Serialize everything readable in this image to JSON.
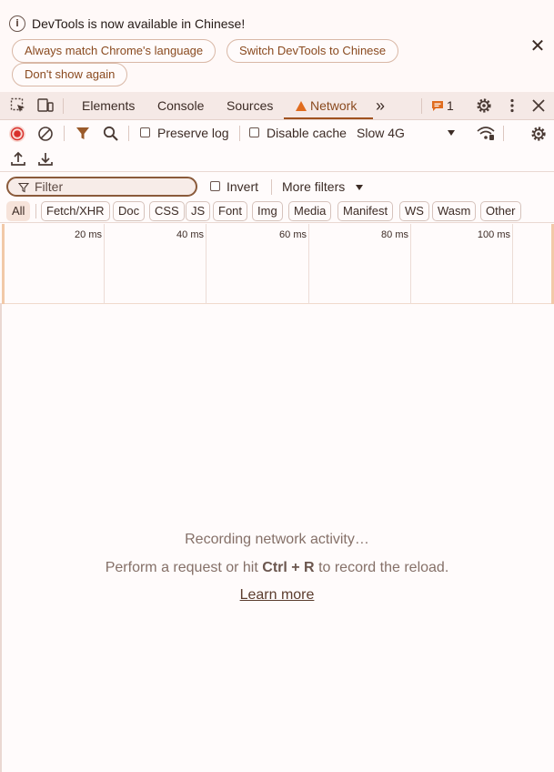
{
  "infobar": {
    "message": "DevTools is now available in Chinese!",
    "buttons": {
      "match_language": "Always match Chrome's language",
      "switch_language": "Switch DevTools to Chinese",
      "dont_show": "Don't show again"
    },
    "close_glyph": "✕"
  },
  "tabs": {
    "elements": "Elements",
    "console": "Console",
    "sources": "Sources",
    "network": "Network",
    "more_glyph": "»",
    "issues_count": "1"
  },
  "network_toolbar": {
    "preserve_log": "Preserve log",
    "disable_cache": "Disable cache",
    "throttling": "Slow 4G"
  },
  "filter": {
    "placeholder": "Filter",
    "invert": "Invert",
    "more_filters": "More filters"
  },
  "type_filters": [
    "All",
    "Fetch/XHR",
    "Doc",
    "CSS",
    "JS",
    "Font",
    "Img",
    "Media",
    "Manifest",
    "WS",
    "Wasm",
    "Other"
  ],
  "timeline": {
    "ticks": [
      "20 ms",
      "40 ms",
      "60 ms",
      "80 ms",
      "100 ms"
    ]
  },
  "empty_state": {
    "recording": "Recording network activity…",
    "prompt_prefix": "Perform a request or hit",
    "shortcut": "Ctrl + R",
    "prompt_suffix": "to record the reload.",
    "learn_more": "Learn more"
  },
  "colors": {
    "accent": "#a0521f",
    "warning": "#e06c1f",
    "record": "#d9302c"
  }
}
